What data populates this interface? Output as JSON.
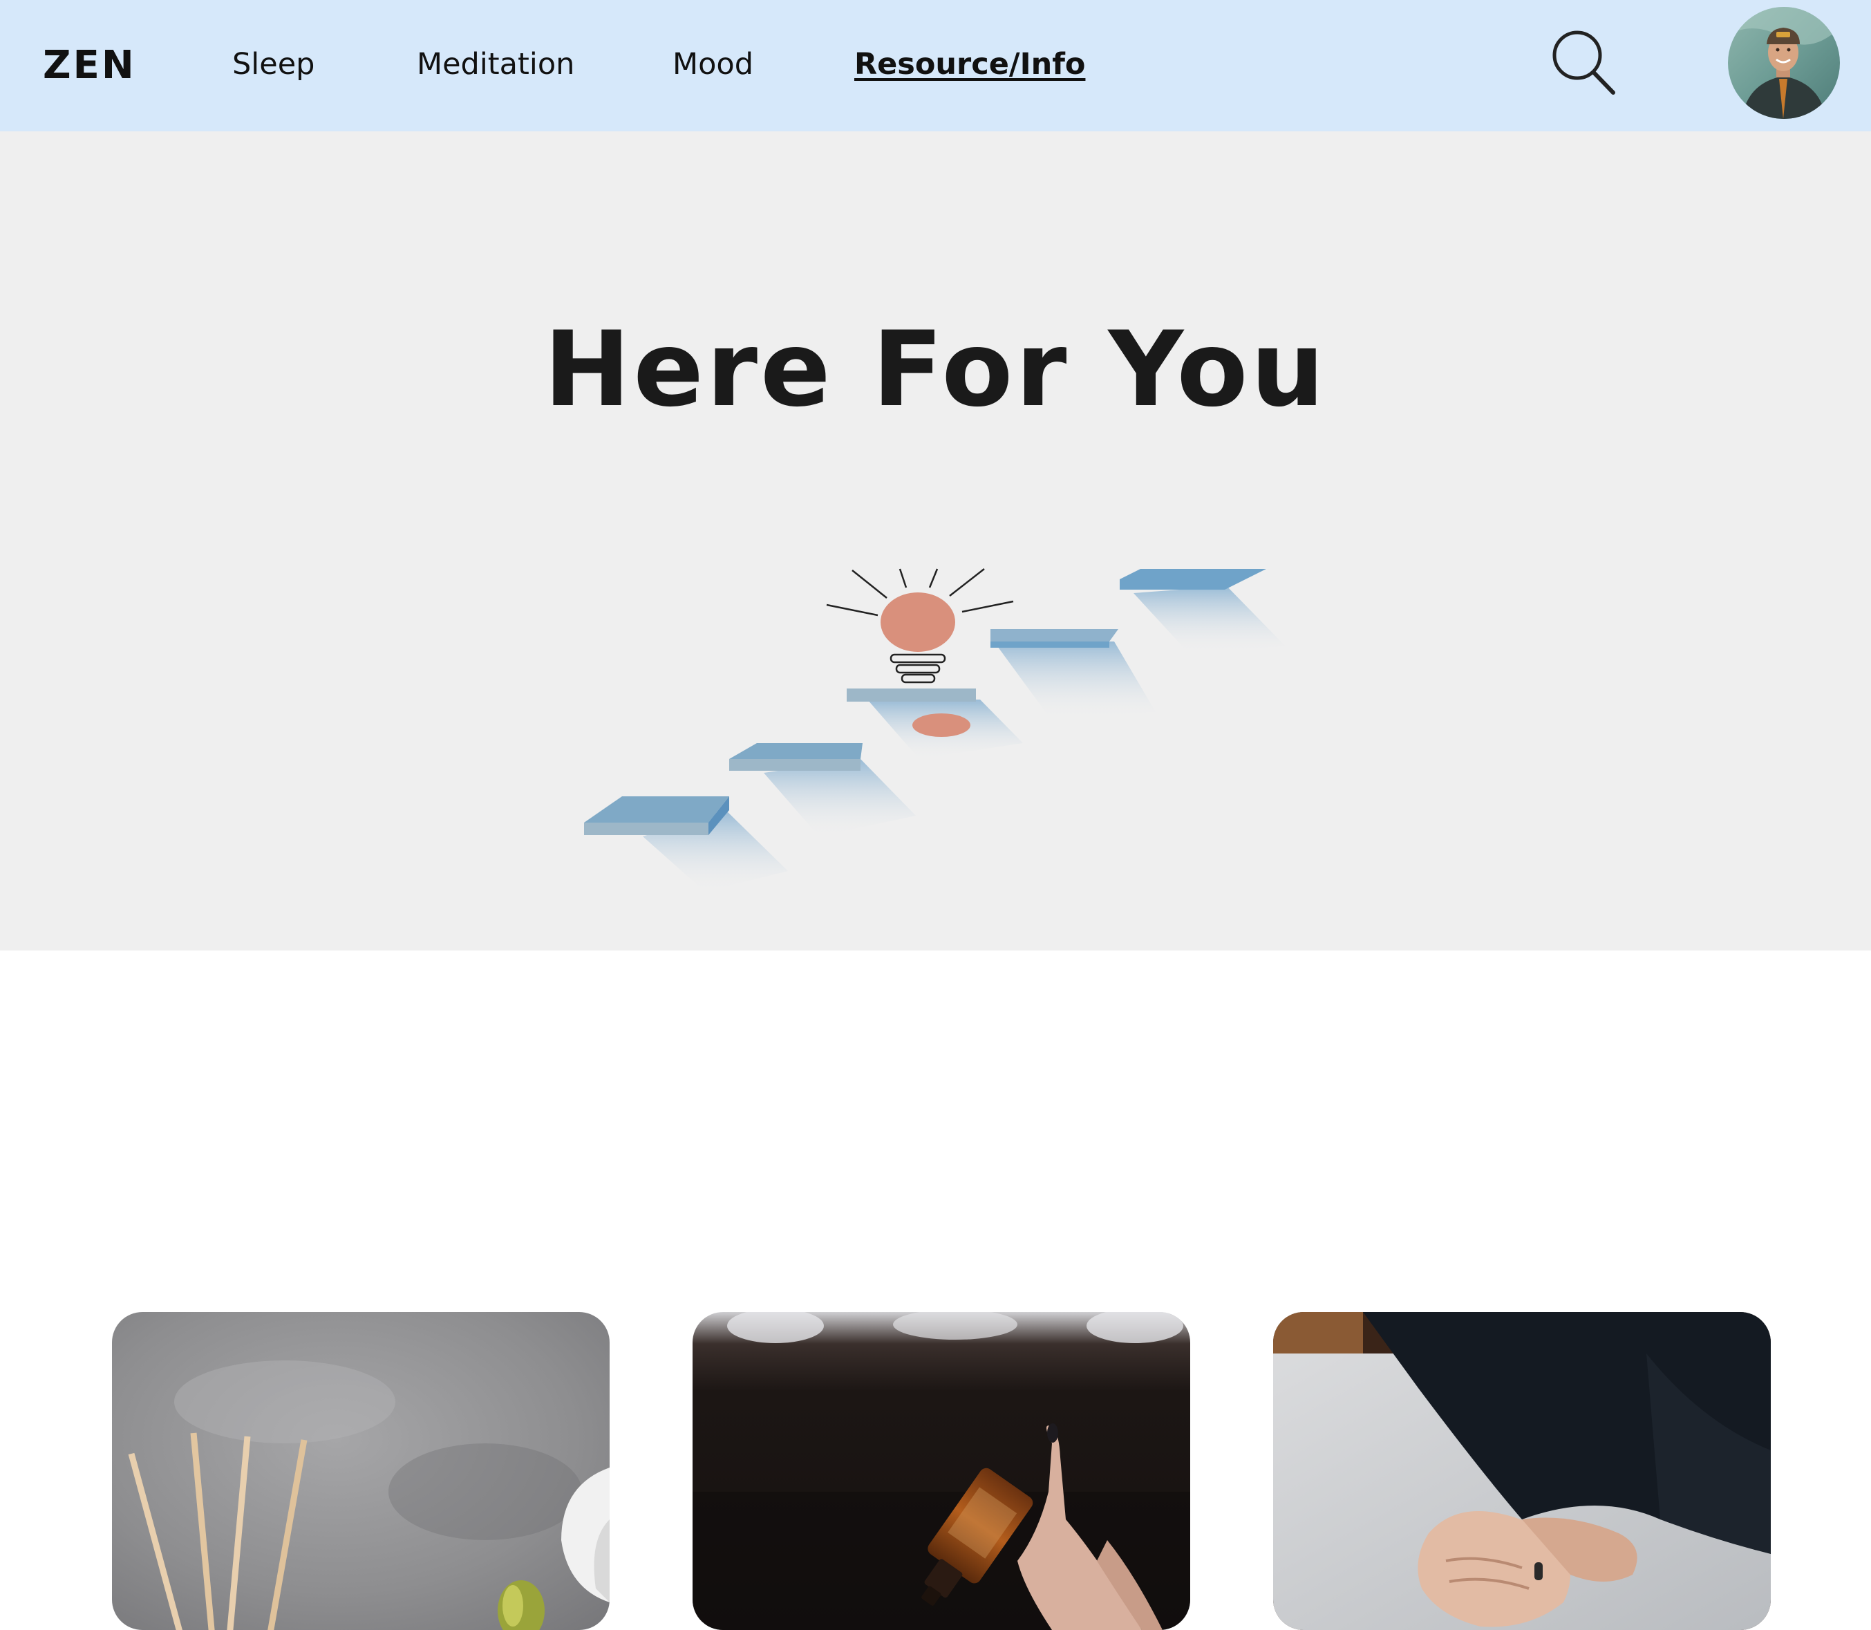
{
  "header": {
    "logo": "ZEN",
    "nav": [
      {
        "label": "Sleep",
        "active": false
      },
      {
        "label": "Meditation",
        "active": false
      },
      {
        "label": "Mood",
        "active": false
      },
      {
        "label": "Resource/Info",
        "active": true
      }
    ],
    "search_icon": "search-icon",
    "avatar_icon": "user-avatar"
  },
  "hero": {
    "title": "Here For You",
    "illustration": "lightbulb-on-stairs"
  },
  "cards": [
    {
      "image": "reed-diffuser-photo"
    },
    {
      "image": "essential-oil-bottle-photo"
    },
    {
      "image": "hands-on-table-photo"
    }
  ],
  "colors": {
    "nav_background": "#d6e8fa",
    "hero_background": "#efefef",
    "accent_bulb": "#d9907c",
    "stairs_blue": "#6fa3c9",
    "text": "#111111"
  }
}
